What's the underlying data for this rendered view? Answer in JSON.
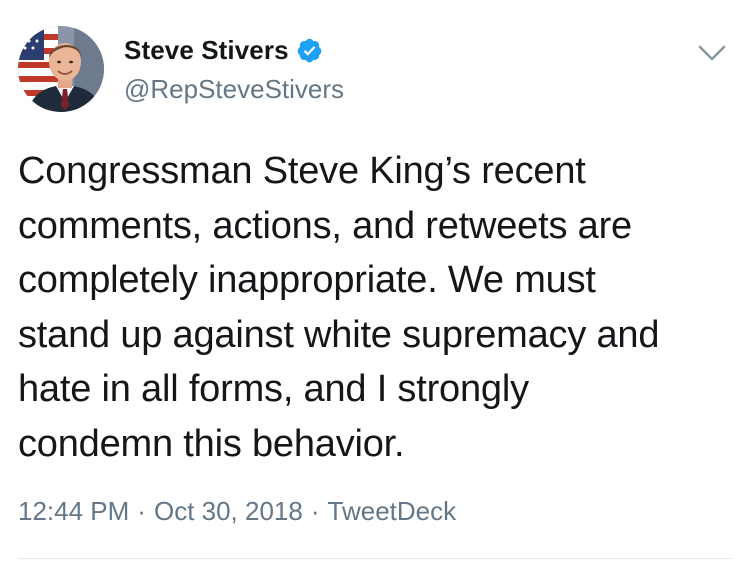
{
  "tweet": {
    "author": {
      "display_name": "Steve Stivers",
      "handle": "@RepSteveStivers",
      "verified": true,
      "avatar_icon": "profile-photo-avatar"
    },
    "text_lines": [
      "Congressman Steve King’s recent",
      "comments, actions, and retweets are",
      "completely inappropriate. We must",
      "stand up against white supremacy and",
      "hate in all forms, and I strongly",
      "condemn this behavior."
    ],
    "time": "12:44 PM",
    "separator": "·",
    "date": "Oct 30, 2018",
    "source": "TweetDeck"
  },
  "colors": {
    "text_primary": "#14171a",
    "text_secondary": "#657786",
    "verified_blue": "#1da1f2",
    "divider": "#e1e8ed"
  },
  "icons": {
    "verified": "verified-badge-icon",
    "menu": "chevron-down-icon"
  }
}
